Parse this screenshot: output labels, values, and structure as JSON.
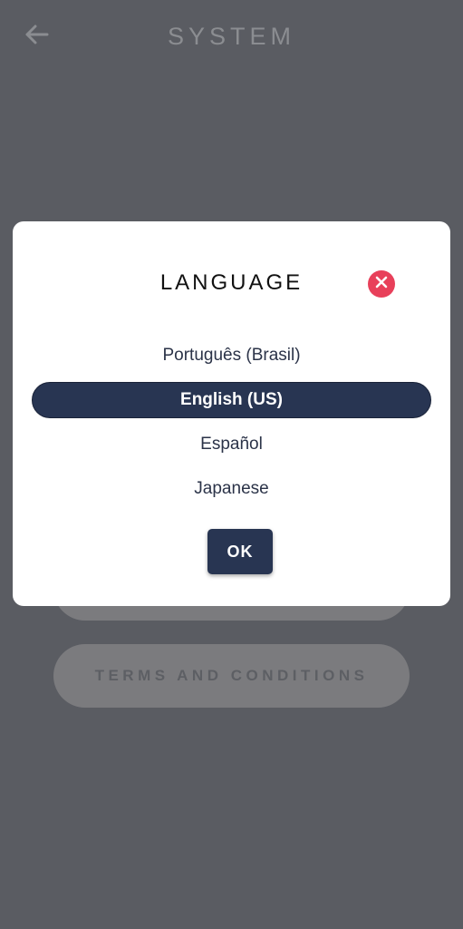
{
  "screen": {
    "title": "SYSTEM",
    "back_icon": "arrow-left-icon",
    "terms_label": "TERMS AND CONDITIONS"
  },
  "dialog": {
    "title": "LANGUAGE",
    "close_icon": "close-icon",
    "options": [
      {
        "label": "Português (Brasil)",
        "selected": false
      },
      {
        "label": "English (US)",
        "selected": true
      },
      {
        "label": "Español",
        "selected": false
      },
      {
        "label": "Japanese",
        "selected": false
      }
    ],
    "ok_label": "OK"
  },
  "colors": {
    "backdrop": "#5a5c62",
    "primary": "#283552",
    "close": "#e8405a"
  }
}
